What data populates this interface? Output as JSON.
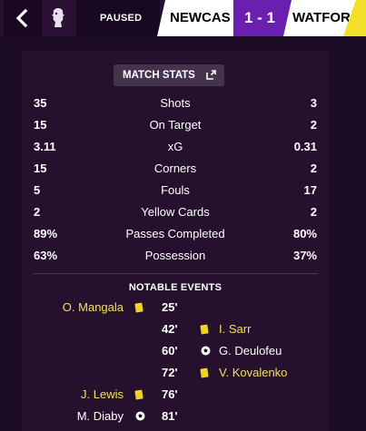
{
  "header": {
    "status": "PAUSED",
    "home_team": "NEWCAS",
    "score": "1 - 1",
    "away_team": "WATFOR"
  },
  "panel": {
    "title": "MATCH STATS",
    "events_title": "NOTABLE EVENTS"
  },
  "stats": [
    {
      "home": "35",
      "label": "Shots",
      "away": "3"
    },
    {
      "home": "15",
      "label": "On Target",
      "away": "2"
    },
    {
      "home": "3.11",
      "label": "xG",
      "away": "0.31"
    },
    {
      "home": "15",
      "label": "Corners",
      "away": "2"
    },
    {
      "home": "5",
      "label": "Fouls",
      "away": "17"
    },
    {
      "home": "2",
      "label": "Yellow Cards",
      "away": "2"
    },
    {
      "home": "89%",
      "label": "Passes Completed",
      "away": "80%"
    },
    {
      "home": "63%",
      "label": "Possession",
      "away": "37%"
    }
  ],
  "events": [
    {
      "minute": "25'",
      "player": "O. Mangala",
      "side": "home",
      "type": "yellow-card"
    },
    {
      "minute": "42'",
      "player": "I. Sarr",
      "side": "away",
      "type": "yellow-card"
    },
    {
      "minute": "60'",
      "player": "G. Deulofeu",
      "side": "away",
      "type": "goal"
    },
    {
      "minute": "72'",
      "player": "V. Kovalenko",
      "side": "away",
      "type": "yellow-card"
    },
    {
      "minute": "76'",
      "player": "J. Lewis",
      "side": "home",
      "type": "yellow-card"
    },
    {
      "minute": "81'",
      "player": "M. Diaby",
      "side": "home",
      "type": "goal"
    }
  ],
  "colors": {
    "accent_purple": "#6b1fb0",
    "yellow_card": "#f2d21b",
    "highlight_yellow": "#efe05a",
    "away_stripe": "#f0e028"
  },
  "icons": {
    "back": "chevron-left-icon",
    "competition": "premier-league-logo-icon",
    "stats_expand": "expand-icon",
    "yellow_card": "yellow-card-icon",
    "goal": "football-icon"
  }
}
